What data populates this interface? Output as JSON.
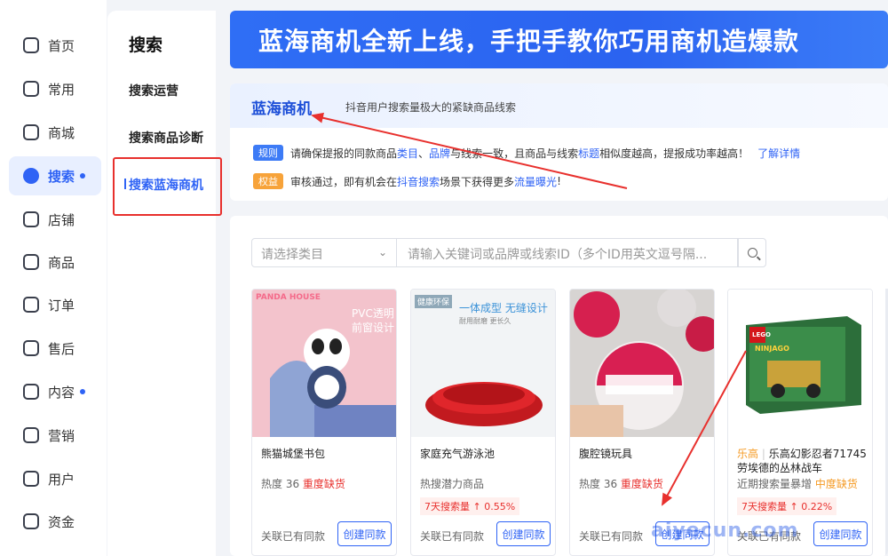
{
  "nav": {
    "items": [
      {
        "label": "首页"
      },
      {
        "label": "常用"
      },
      {
        "label": "商城"
      },
      {
        "label": "搜索"
      },
      {
        "label": "店铺"
      },
      {
        "label": "商品"
      },
      {
        "label": "订单"
      },
      {
        "label": "售后"
      },
      {
        "label": "内容"
      },
      {
        "label": "营销"
      },
      {
        "label": "用户"
      },
      {
        "label": "资金"
      }
    ]
  },
  "subnav": {
    "title": "搜索",
    "items": [
      {
        "label": "搜索运营"
      },
      {
        "label": "搜索商品诊断"
      },
      {
        "label": "搜索蓝海商机"
      }
    ]
  },
  "banner": {
    "text": "蓝海商机全新上线，手把手教你巧用商机造爆款"
  },
  "info": {
    "title": "蓝海商机",
    "subtitle": "抖音用户搜索量极大的紧缺商品线索",
    "rule_tag": "规则",
    "rule_text_1": "请确保提报的同款商品",
    "rule_link_1": "类目",
    "rule_sep": "、",
    "rule_link_2": "品牌",
    "rule_text_2": "与线索一致，且商品与线索",
    "rule_link_3": "标题",
    "rule_text_3": "相似度越高，提报成功率越高！",
    "rule_more": "了解详情",
    "benefit_tag": "权益",
    "benefit_text_1": "审核通过，即有机会在",
    "benefit_link_1": "抖音搜索",
    "benefit_text_2": "场景下获得更多",
    "benefit_link_2": "流量曝光",
    "benefit_text_3": "!"
  },
  "search": {
    "category_placeholder": "请选择类目",
    "keyword_placeholder": "请输入关键词或品牌或线索ID（多个ID用英文逗号隔..."
  },
  "cards": [
    {
      "title": "熊猫城堡书包",
      "heat_label": "热度 36",
      "heat_status": "重度缺货",
      "trend": "",
      "assoc": "关联已有同款",
      "button": "创建同款",
      "img_brand": "PANDA HOUSE",
      "img_line1": "PVC透明",
      "img_line2": "前窗设计"
    },
    {
      "title": "家庭充气游泳池",
      "heat_label": "热搜潜力商品",
      "heat_status": "",
      "trend": "7天搜索量 ↑ 0.55%",
      "assoc": "关联已有同款",
      "button": "创建同款",
      "img_tag": "健康环保",
      "img_line1": "一体成型 无缝设计",
      "img_line2": "耐用耐磨 更长久"
    },
    {
      "title": "腹腔镜玩具",
      "heat_label": "热度 36",
      "heat_status": "重度缺货",
      "trend": "",
      "assoc": "关联已有同款",
      "button": "创建同款"
    },
    {
      "title_brand": "乐高",
      "title": "乐高幻影忍者71745劳埃德的丛林战车",
      "heat_label": "近期搜索量暴增",
      "heat_status": "中度缺货",
      "trend": "7天搜索量 ↑ 0.22%",
      "assoc": "关联已有同款",
      "button": "创建同款",
      "img_brand": "LEGO",
      "img_line1": "NINJAGO"
    }
  ],
  "watermark": "aiyecun.com",
  "colors": {
    "accent": "#2f63f5",
    "alert": "#e8302d",
    "warning": "#f59a23"
  }
}
